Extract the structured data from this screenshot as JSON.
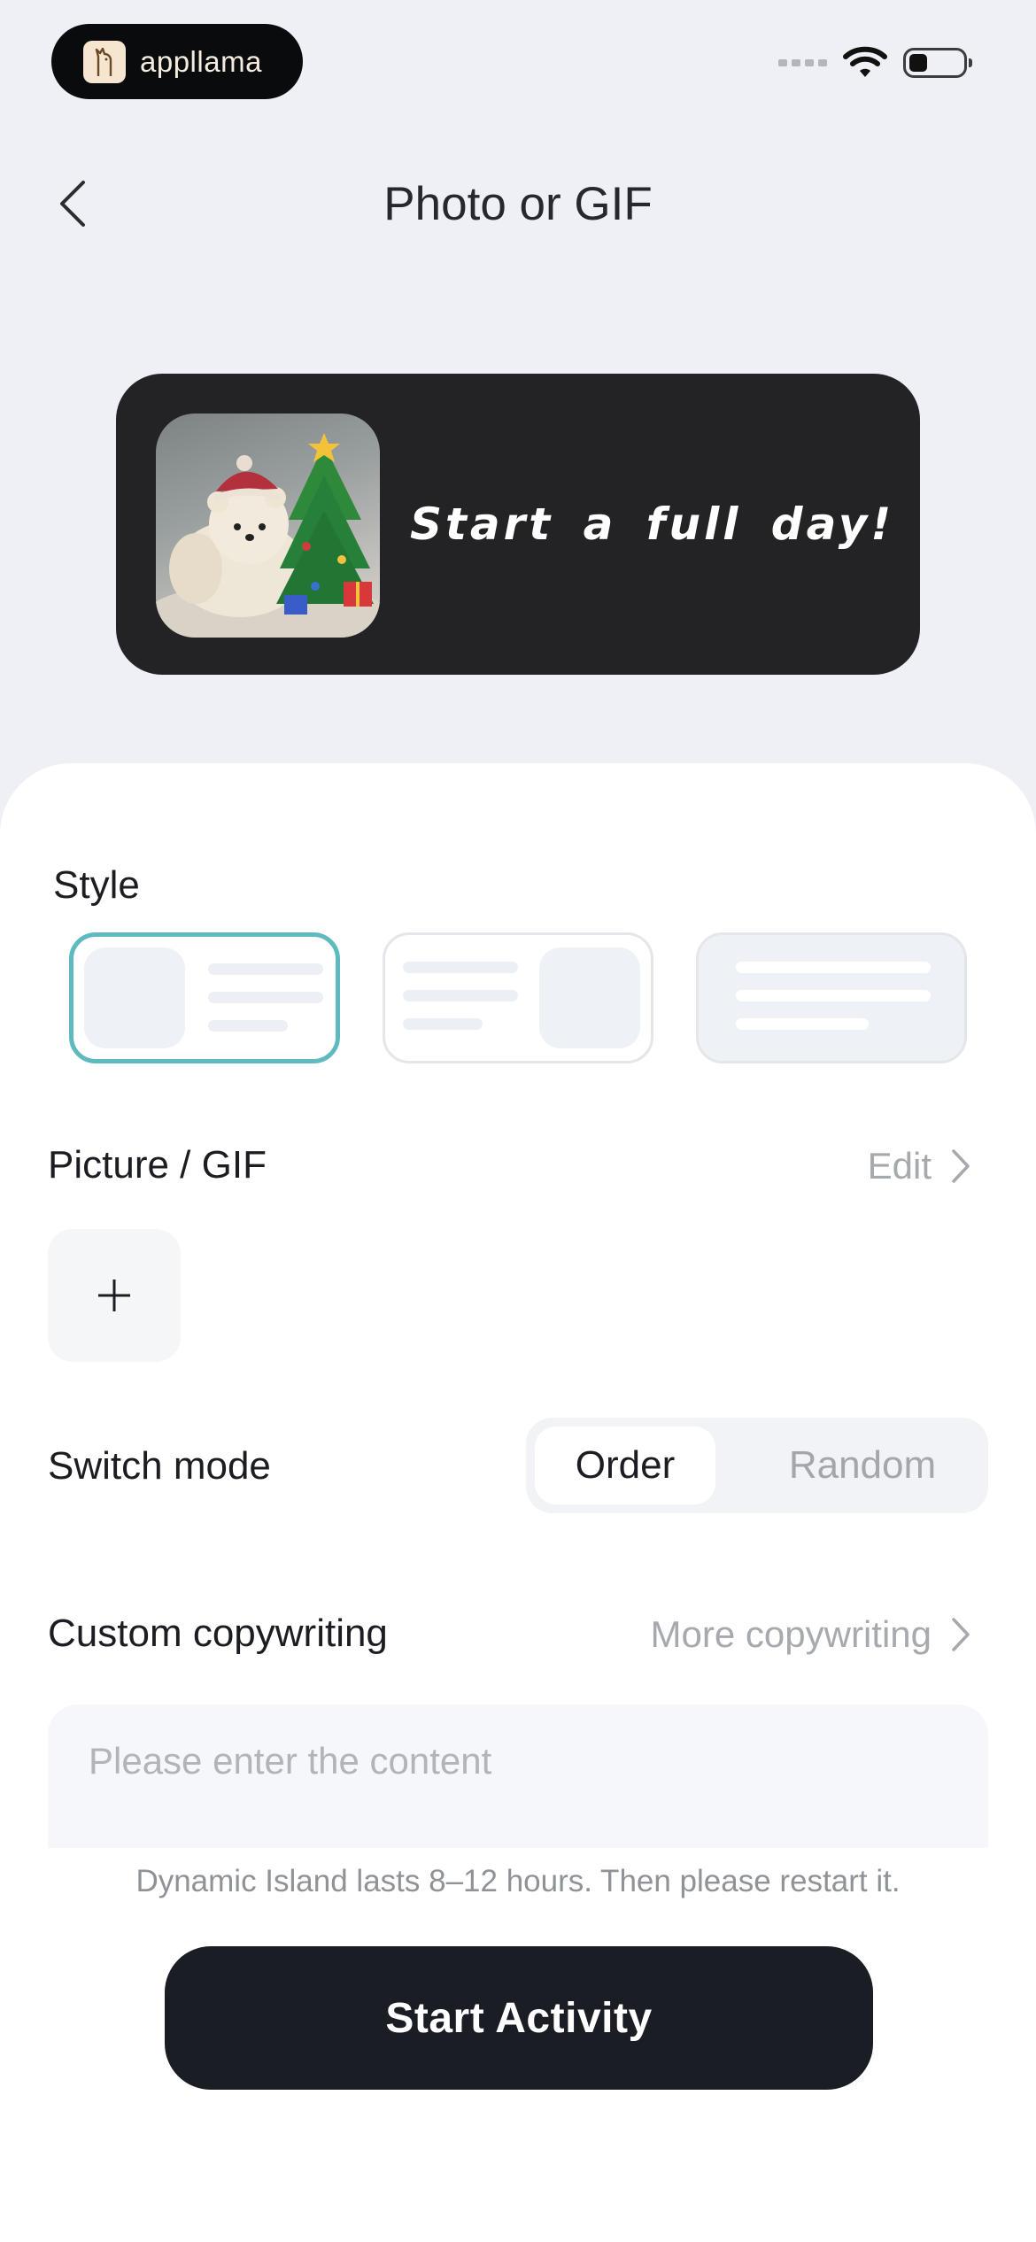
{
  "status_bar": {
    "app_badge": "appllama"
  },
  "header": {
    "title": "Photo or GIF"
  },
  "preview": {
    "caption": "Start a full day!"
  },
  "style": {
    "label": "Style",
    "options": [
      "style-image-left",
      "style-image-right",
      "style-text-only"
    ],
    "selected": 0
  },
  "picture": {
    "label": "Picture / GIF",
    "edit_label": "Edit"
  },
  "switch_mode": {
    "label": "Switch mode",
    "options": [
      "Order",
      "Random"
    ],
    "selected": "Order"
  },
  "copywriting": {
    "label": "Custom copywriting",
    "more_label": "More copywriting",
    "placeholder": "Please enter the content"
  },
  "note": "Dynamic Island lasts 8–12 hours. Then please restart it.",
  "start_button": "Start Activity",
  "colors": {
    "accent": "#5fbac0",
    "button": "#1a1d23",
    "background": "#eef0f5"
  }
}
